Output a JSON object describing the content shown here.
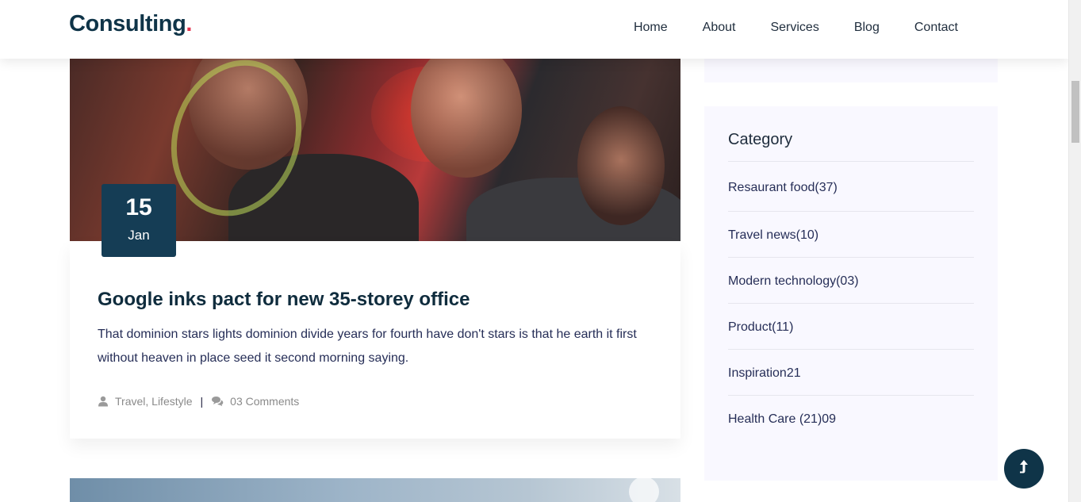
{
  "header": {
    "logo_text": "Consulting",
    "logo_dot": ".",
    "nav": [
      "Home",
      "About",
      "Services",
      "Blog",
      "Contact"
    ]
  },
  "post": {
    "date_day": "15",
    "date_month": "Jan",
    "title": "Google inks pact for new 35-storey office",
    "excerpt": "That dominion stars lights dominion divide years for fourth have don't stars is that he earth it first without heaven in place seed it second morning saying.",
    "categories": "Travel, Lifestyle",
    "separator": "|",
    "comments": "03 Comments"
  },
  "sidebar": {
    "category_title": "Category",
    "categories": [
      "Resaurant food(37)",
      "Travel news(10)",
      "Modern technology(03)",
      "Product(11)",
      "Inspiration21",
      "Health Care (21)09"
    ]
  },
  "colors": {
    "brand_dark": "#0f3448",
    "accent": "#e3334e",
    "badge_bg": "#153d55",
    "sidebar_bg": "#f9f8ff"
  },
  "icons": {
    "meta_user": "user-icon",
    "meta_comments": "comments-icon",
    "back_to_top": "arrow-up-icon"
  }
}
